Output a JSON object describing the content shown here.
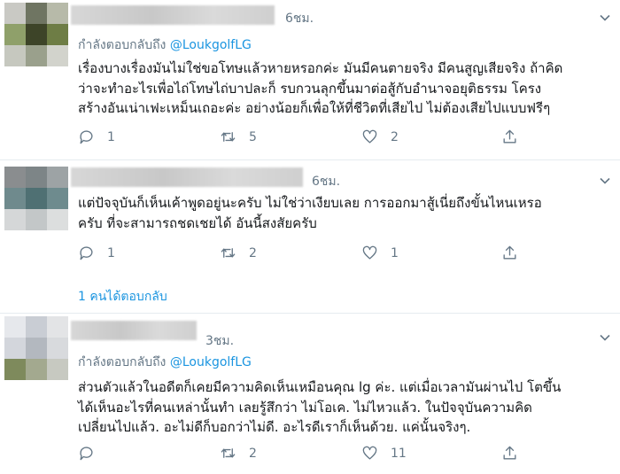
{
  "tweets": [
    {
      "time": "6ชม.",
      "replying_prefix": "กำลังตอบกลับถึง",
      "replying_handle": "@LoukgolfLG",
      "body_lines": [
        "เรื่องบางเรื่องมันไม่ใช่ขอโทษแล้วหายหรอกค่ะ มันมีคนตายจริง มีคนสูญเสียจริง ถ้าคิด",
        "ว่าจะทำอะไรเพื่อไถ่โทษไถ่บาปละก็ รบกวนลุกขึ้นมาต่อสู้กับอำนาจอยุติธรรม โครง",
        "สร้างอันเน่าเฟะเหม็นเถอะค่ะ อย่างน้อยก็เพื่อให้ที่ชีวิตที่เสียไป ไม่ต้องเสียไปแบบฟรีๆ"
      ],
      "reply_count": "1",
      "retweet_count": "5",
      "like_count": "2"
    },
    {
      "time": "6ชม.",
      "body_lines": [
        "แต่ปัจจุบันก็เห็นเค้าพูดอยู่นะครับ ไม่ใช่ว่าเงียบเลย การออกมาสู้เนี่ยถึงขั้นไหนเหรอ",
        "ครับ ที่จะสามารถชดเชยได้ อันนี้สงสัยครับ"
      ],
      "reply_count": "1",
      "retweet_count": "2",
      "like_count": "1",
      "more_replies": "1 คนได้ตอบกลับ"
    },
    {
      "time": "3ชม.",
      "replying_prefix": "กำลังตอบกลับถึง",
      "replying_handle": "@LoukgolfLG",
      "body_lines": [
        "ส่วนตัวแล้วในอดีตก็เคยมีความคิดเห็นเหมือนคุณ lg ค่ะ. แต่เมื่อเวลามันผ่านไป โตขึ้น",
        "ได้เห็นอะไรที่คนเหล่านั้นทำ เลยรู้สึกว่า ไม่โอเค. ไม่ไหวแล้ว. ในปัจจุบันความคิด",
        "เปลี่ยนไปแล้ว. อะไม่ดีก็บอกว่าไม่ดี. อะไรดีเราก็เห็นด้วย. แค่นั้นจริงๆ."
      ],
      "reply_count": "",
      "retweet_count": "2",
      "like_count": "11"
    }
  ],
  "colors": {
    "accent": "#1b95e0",
    "secondary_text": "#657786",
    "divider": "#e6ecf0"
  },
  "icons": [
    "reply-icon",
    "retweet-icon",
    "like-icon",
    "share-icon",
    "chevron-down-icon"
  ]
}
